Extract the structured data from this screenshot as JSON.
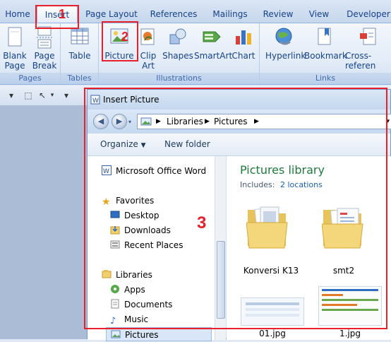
{
  "tabs": [
    {
      "label": "Home"
    },
    {
      "label": "Insert",
      "active": true
    },
    {
      "label": "Page Layout"
    },
    {
      "label": "References"
    },
    {
      "label": "Mailings"
    },
    {
      "label": "Review"
    },
    {
      "label": "View"
    },
    {
      "label": "Developer"
    }
  ],
  "ribbon": {
    "groups": [
      "Pages",
      "Tables",
      "Illustrations",
      "Links"
    ],
    "buttons": {
      "blank_page": "Blank Page",
      "page_break": "Page Break",
      "table": "Table",
      "picture": "Picture",
      "clip_art": "Clip Art",
      "shapes": "Shapes",
      "smartart": "SmartArt",
      "chart": "Chart",
      "hyperlink": "Hyperlink",
      "bookmark": "Bookmark",
      "cross_reference": "Cross-referen"
    }
  },
  "annotations": {
    "n1": "1",
    "n2": "2",
    "n3": "3"
  },
  "dialog": {
    "title": "Insert Picture",
    "breadcrumb": [
      "Libraries",
      "Pictures"
    ],
    "toolbar": {
      "organize": "Organize",
      "new_folder": "New folder"
    },
    "nav": {
      "top_item": "Microsoft Office Word",
      "favorites": "Favorites",
      "favorites_items": [
        "Desktop",
        "Downloads",
        "Recent Places"
      ],
      "libraries": "Libraries",
      "libraries_items": [
        "Apps",
        "Documents",
        "Music",
        "Pictures"
      ]
    },
    "library": {
      "title": "Pictures library",
      "includes_label": "Includes:",
      "includes_link": "2 locations"
    },
    "items": [
      {
        "name": "Konversi K13"
      },
      {
        "name": "smt2"
      },
      {
        "name": "01.jpg"
      },
      {
        "name": "1.jpg"
      }
    ]
  },
  "colors": {
    "annotation": "#e8202c",
    "library_title": "#1e7a3d",
    "link": "#1a5fb4"
  }
}
